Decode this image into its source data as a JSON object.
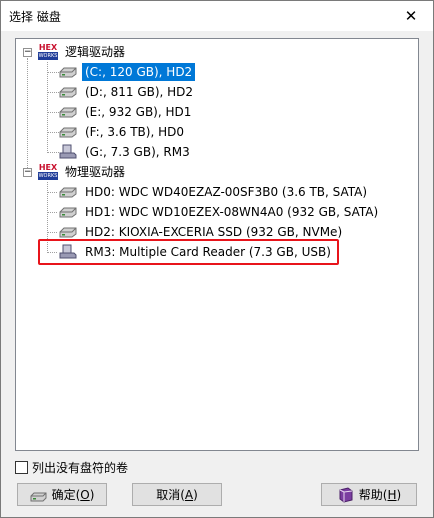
{
  "window": {
    "title": "选择 磁盘",
    "close_glyph": "✕"
  },
  "tree": {
    "logical_group": {
      "label": "逻辑驱动器",
      "icon_top": "HEX",
      "icon_bottom": "WORKS",
      "expanded_glyph": "−"
    },
    "logical_items": [
      {
        "label": "(C:, 120 GB), HD2",
        "icon": "hard-drive-icon",
        "selected": true
      },
      {
        "label": "(D:, 811 GB), HD2",
        "icon": "hard-drive-icon",
        "selected": false
      },
      {
        "label": "(E:, 932 GB), HD1",
        "icon": "hard-drive-icon",
        "selected": false
      },
      {
        "label": "(F:, 3.6 TB), HD0",
        "icon": "hard-drive-icon",
        "selected": false
      },
      {
        "label": "(G:, 7.3 GB), RM3",
        "icon": "removable-drive-icon",
        "selected": false
      }
    ],
    "physical_group": {
      "label": "物理驱动器",
      "icon_top": "HEX",
      "icon_bottom": "WORKS",
      "expanded_glyph": "−"
    },
    "physical_items": [
      {
        "label": "HD0: WDC WD40EZAZ-00SF3B0 (3.6 TB, SATA)",
        "icon": "hard-drive-icon"
      },
      {
        "label": "HD1: WDC WD10EZEX-08WN4A0 (932 GB, SATA)",
        "icon": "hard-drive-icon"
      },
      {
        "label": "HD2: KIOXIA-EXCERIA SSD (932 GB, NVMe)",
        "icon": "hard-drive-icon"
      },
      {
        "label": "RM3: Multiple Card Reader (7.3 GB, USB)",
        "icon": "removable-drive-icon"
      }
    ]
  },
  "options": {
    "show_unlettered_volumes": {
      "label": "列出没有盘符的卷",
      "checked": false
    }
  },
  "buttons": {
    "ok": {
      "label": "确定(",
      "hotkey": "O",
      "suffix": ")"
    },
    "cancel": {
      "label": "取消(",
      "hotkey": "A",
      "suffix": ")"
    },
    "help": {
      "label": "帮助(",
      "hotkey": "H",
      "suffix": ")"
    }
  },
  "colors": {
    "selection": "#0078d7",
    "highlight_annotation": "#e8141b"
  }
}
